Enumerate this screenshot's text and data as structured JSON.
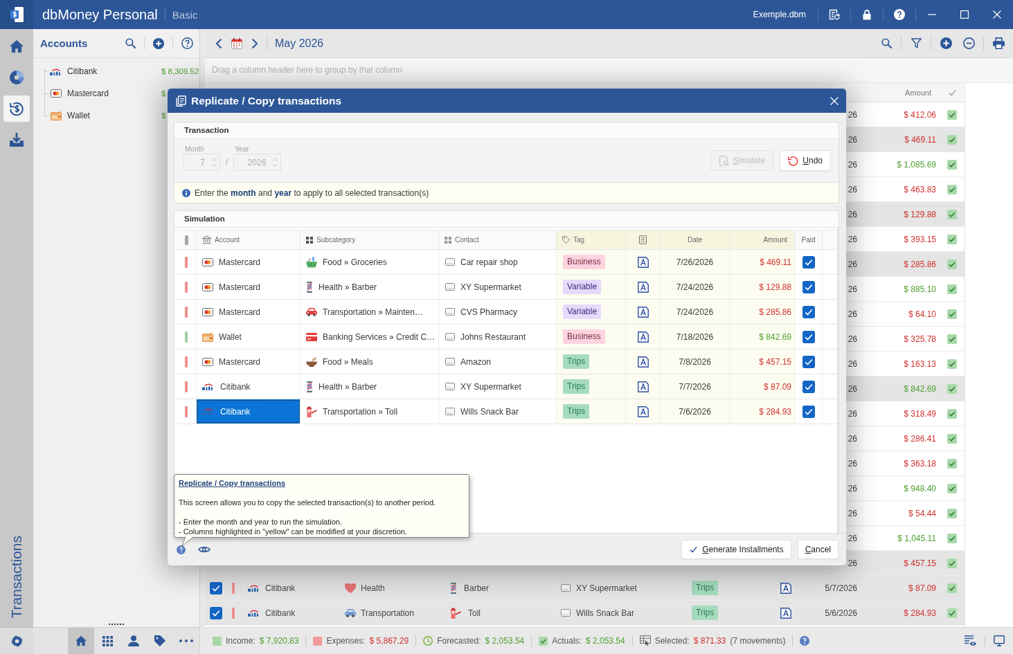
{
  "window": {
    "title": "dbMoney Personal",
    "edition": "Basic",
    "file": "Exemple.dbm"
  },
  "nav_rail": {
    "items": [
      {
        "kind": "home",
        "selected": false
      },
      {
        "kind": "reports",
        "selected": false
      },
      {
        "kind": "transactions",
        "selected": true
      },
      {
        "kind": "import",
        "selected": false
      }
    ],
    "section_label": "Transactions"
  },
  "accounts_panel": {
    "title": "Accounts",
    "accounts": [
      {
        "name": "Citibank",
        "kind": "bank",
        "balance": "$ 8,309.52"
      },
      {
        "name": "Mastercard",
        "kind": "card",
        "balance": "$"
      },
      {
        "name": "Wallet",
        "kind": "wallet",
        "balance": "$"
      }
    ],
    "bottom_tabs": [
      {
        "kind": "home",
        "selected": true
      },
      {
        "kind": "categories",
        "selected": false
      },
      {
        "kind": "contacts",
        "selected": false
      },
      {
        "kind": "tags",
        "selected": false
      },
      {
        "kind": "more",
        "selected": false
      }
    ]
  },
  "toolbar": {
    "period": "May 2026"
  },
  "group_hint": "Drag a column header here to group by that column",
  "grid": {
    "amount_header": "Amount",
    "rows": [
      {
        "kind": "expense",
        "selected": false,
        "date": "26",
        "amount": "$ 412.06",
        "paid": true
      },
      {
        "kind": "expense",
        "selected": true,
        "date": "26",
        "amount": "$ 469.11",
        "paid": true
      },
      {
        "kind": "income",
        "selected": false,
        "date": "26",
        "amount": "$ 1,085.69",
        "paid": true
      },
      {
        "kind": "expense",
        "selected": false,
        "date": "26",
        "amount": "$ 463.83",
        "paid": true
      },
      {
        "kind": "expense",
        "selected": true,
        "date": "26",
        "amount": "$ 129.88",
        "paid": true
      },
      {
        "kind": "expense",
        "selected": false,
        "date": "26",
        "amount": "$ 393.15",
        "paid": true
      },
      {
        "kind": "expense",
        "selected": true,
        "date": "26",
        "amount": "$ 285.86",
        "paid": true
      },
      {
        "kind": "income",
        "selected": false,
        "date": "26",
        "amount": "$ 885.10",
        "paid": true
      },
      {
        "kind": "expense",
        "selected": false,
        "date": "26",
        "amount": "$ 64.10",
        "paid": true
      },
      {
        "kind": "expense",
        "selected": false,
        "date": "26",
        "amount": "$ 325.78",
        "paid": true
      },
      {
        "kind": "expense",
        "selected": false,
        "date": "26",
        "amount": "$ 163.13",
        "paid": true
      },
      {
        "kind": "income",
        "selected": true,
        "date": "26",
        "amount": "$ 842.69",
        "paid": true
      },
      {
        "kind": "expense",
        "selected": false,
        "date": "26",
        "amount": "$ 318.49",
        "paid": true
      },
      {
        "kind": "expense",
        "selected": false,
        "date": "26",
        "amount": "$ 286.41",
        "paid": true
      },
      {
        "kind": "expense",
        "selected": false,
        "date": "26",
        "amount": "$ 363.18",
        "paid": true
      },
      {
        "kind": "income",
        "selected": false,
        "date": "26",
        "amount": "$ 948.40",
        "paid": true
      },
      {
        "kind": "expense",
        "selected": false,
        "date": "26",
        "amount": "$ 54.44",
        "paid": true
      },
      {
        "kind": "income",
        "selected": false,
        "date": "26",
        "amount": "$ 1,045.11",
        "paid": true
      },
      {
        "kind": "expense",
        "selected": true,
        "date": "26",
        "amount": "$ 457.15",
        "paid": true
      },
      {
        "kind": "expense",
        "selected": true,
        "checked": true,
        "account": {
          "name": "Citibank",
          "kind": "bank"
        },
        "category": {
          "name": "Health",
          "kind": "health"
        },
        "subcategory": {
          "name": "Barber",
          "kind": "barber"
        },
        "contact": "XY Supermarket",
        "tag": {
          "label": "Trips",
          "color": "#a6dbbf"
        },
        "note": true,
        "date": "5/7/2026",
        "amount": "$ 87.09",
        "paid": true
      },
      {
        "kind": "expense",
        "selected": true,
        "checked": true,
        "account": {
          "name": "Citibank",
          "kind": "bank"
        },
        "category": {
          "name": "Transportation",
          "kind": "transport"
        },
        "subcategory": {
          "name": "Toll",
          "kind": "toll"
        },
        "contact": "Wills Snack Bar",
        "tag": {
          "label": "Trips",
          "color": "#a6dbbf"
        },
        "note": true,
        "date": "5/6/2026",
        "amount": "$ 284.93",
        "paid": true
      }
    ]
  },
  "status_bar": {
    "items": [
      {
        "kind": "income",
        "label": "Income:",
        "value": "$ 7,920.83",
        "negative": false
      },
      {
        "kind": "expenses",
        "label": "Expenses:",
        "value": "$ 5,867.29",
        "negative": true
      },
      {
        "kind": "forecasted",
        "label": "Forecasted:",
        "value": "$ 2,053.54",
        "negative": false
      },
      {
        "kind": "actuals",
        "label": "Actuals:",
        "value": "$ 2,053.54",
        "negative": false
      },
      {
        "kind": "selected",
        "label": "Selected:",
        "value": "$ 871.33",
        "note": "(7 movements)",
        "negative": true
      }
    ]
  },
  "dialog": {
    "title": "Replicate / Copy transactions",
    "transaction": {
      "title": "Transaction",
      "month": {
        "label": "Month",
        "value": "7",
        "disabled": true
      },
      "separator": "/",
      "year": {
        "label": "Year",
        "value": "2026",
        "disabled": true
      },
      "actions": [
        {
          "kind": "simulate",
          "label": "Simulate",
          "disabled": true
        },
        {
          "kind": "undo",
          "label": "Undo",
          "disabled": false
        }
      ],
      "info": "Enter the **month** and **year** to apply to all selected transaction(s)"
    },
    "simulation": {
      "title": "Simulation",
      "columns": [
        {
          "kind": "marker",
          "editable": false
        },
        {
          "kind": "account",
          "label": "Account",
          "editable": false
        },
        {
          "kind": "subcategory",
          "label": "Subcategory",
          "editable": false
        },
        {
          "kind": "contact",
          "label": "Contact",
          "editable": false
        },
        {
          "kind": "tag",
          "label": "Tag",
          "editable": true
        },
        {
          "kind": "note",
          "editable": true
        },
        {
          "kind": "date",
          "label": "Date",
          "editable": true
        },
        {
          "kind": "amount",
          "label": "Amount",
          "editable": true
        },
        {
          "kind": "paid",
          "label": "Paid",
          "editable": false
        }
      ],
      "rows": [
        {
          "kind": "expense",
          "account": {
            "name": "Mastercard",
            "kind": "card",
            "focused": false
          },
          "subcategory": {
            "path": "Food » Groceries",
            "kind": "groceries"
          },
          "contact": "Car repair shop",
          "tag": {
            "label": "Business",
            "color": "#fbd4df"
          },
          "note": true,
          "date": "7/26/2026",
          "amount": "$ 469.11",
          "paid": true
        },
        {
          "kind": "expense",
          "account": {
            "name": "Mastercard",
            "kind": "card",
            "focused": false
          },
          "subcategory": {
            "path": "Health » Barber",
            "kind": "barber"
          },
          "contact": "XY Supermarket",
          "tag": {
            "label": "Variable",
            "color": "#e5dafb"
          },
          "note": true,
          "date": "7/24/2026",
          "amount": "$ 129.88",
          "paid": true
        },
        {
          "kind": "expense",
          "account": {
            "name": "Mastercard",
            "kind": "card",
            "focused": false
          },
          "subcategory": {
            "path": "Transportation » Mainten…",
            "kind": "auto"
          },
          "contact": "CVS Pharmacy",
          "tag": {
            "label": "Variable",
            "color": "#e5dafb"
          },
          "note": true,
          "date": "7/24/2026",
          "amount": "$ 285.86",
          "paid": true
        },
        {
          "kind": "income",
          "account": {
            "name": "Wallet",
            "kind": "wallet",
            "focused": false
          },
          "subcategory": {
            "path": "Banking Services » Credit C…",
            "kind": "card"
          },
          "contact": "Johns Restaurant",
          "tag": {
            "label": "Business",
            "color": "#fbd4df"
          },
          "note": true,
          "date": "7/18/2026",
          "amount": "$ 842.69",
          "paid": true
        },
        {
          "kind": "expense",
          "account": {
            "name": "Mastercard",
            "kind": "card",
            "focused": false
          },
          "subcategory": {
            "path": "Food » Meals",
            "kind": "meals"
          },
          "contact": "Amazon",
          "tag": {
            "label": "Trips",
            "color": "#a6dbbf"
          },
          "note": true,
          "date": "7/8/2026",
          "amount": "$ 457.15",
          "paid": true
        },
        {
          "kind": "expense",
          "account": {
            "name": "Citibank",
            "kind": "bank",
            "focused": false
          },
          "subcategory": {
            "path": "Health » Barber",
            "kind": "barber"
          },
          "contact": "XY Supermarket",
          "tag": {
            "label": "Trips",
            "color": "#a6dbbf"
          },
          "note": true,
          "date": "7/7/2026",
          "amount": "$ 87.09",
          "paid": true
        },
        {
          "kind": "expense",
          "account": {
            "name": "Citibank",
            "kind": "bank",
            "focused": true
          },
          "subcategory": {
            "path": "Transportation » Toll",
            "kind": "toll"
          },
          "contact": "Wills Snack Bar",
          "tag": {
            "label": "Trips",
            "color": "#a6dbbf"
          },
          "note": true,
          "date": "7/6/2026",
          "amount": "$ 284.93",
          "paid": true
        }
      ]
    },
    "tooltip": {
      "title": "Replicate / Copy transactions",
      "text": "This screen allows you to copy the selected transaction(s) to another period.",
      "notes": [
        "- Enter the month and year to run the simulation.",
        "- Columns highlighted in \"yellow\" can be modified at your discretion."
      ]
    },
    "buttons": [
      {
        "kind": "generate",
        "label": "Generate Installments"
      },
      {
        "kind": "cancel",
        "label": "Cancel"
      }
    ]
  }
}
